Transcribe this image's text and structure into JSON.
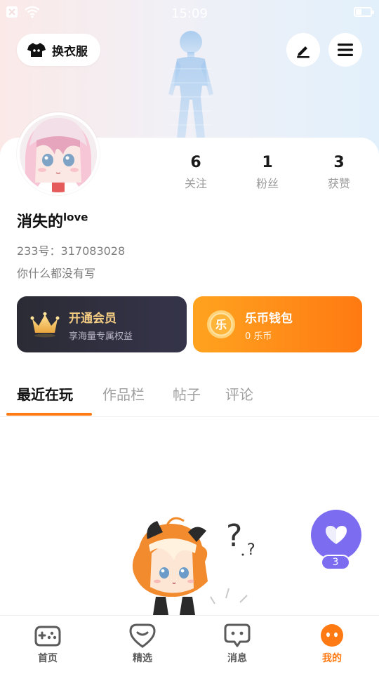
{
  "status_bar": {
    "time": "15:09",
    "battery_level": 0.35
  },
  "header": {
    "dress_up_label": "换衣服",
    "edit_icon": "pen-icon",
    "menu_icon": "hamburger-menu-icon"
  },
  "profile": {
    "username": "消失的",
    "username_suffix": "love",
    "uid": "233号：317083028",
    "bio": "你什么都没有写",
    "stats": [
      {
        "value": "6",
        "label": "关注"
      },
      {
        "value": "1",
        "label": "粉丝"
      },
      {
        "value": "3",
        "label": "获赞"
      }
    ]
  },
  "cards": {
    "vip": {
      "title": "开通会员",
      "subtitle": "享海量专属权益",
      "icon": "crown-icon"
    },
    "wallet": {
      "title": "乐币钱包",
      "subtitle": "0 乐币",
      "coin_glyph": "乐",
      "icon": "coin-icon"
    }
  },
  "tabs": [
    {
      "label": "最近在玩",
      "active": true
    },
    {
      "label": "作品栏",
      "active": false
    },
    {
      "label": "帖子",
      "active": false
    },
    {
      "label": "评论",
      "active": false
    }
  ],
  "like_widget": {
    "count": "3",
    "icon": "heart-icon"
  },
  "bottom_nav": [
    {
      "label": "首页",
      "icon": "gamepad-icon",
      "active": false
    },
    {
      "label": "精选",
      "icon": "heart-badge-icon",
      "active": false
    },
    {
      "label": "消息",
      "icon": "chat-icon",
      "active": false
    },
    {
      "label": "我的",
      "icon": "profile-face-icon",
      "active": true
    }
  ],
  "colors": {
    "accent": "#ff7a12",
    "vip_gold": "#f4cd83",
    "like_purple": "#7c6cf0"
  }
}
